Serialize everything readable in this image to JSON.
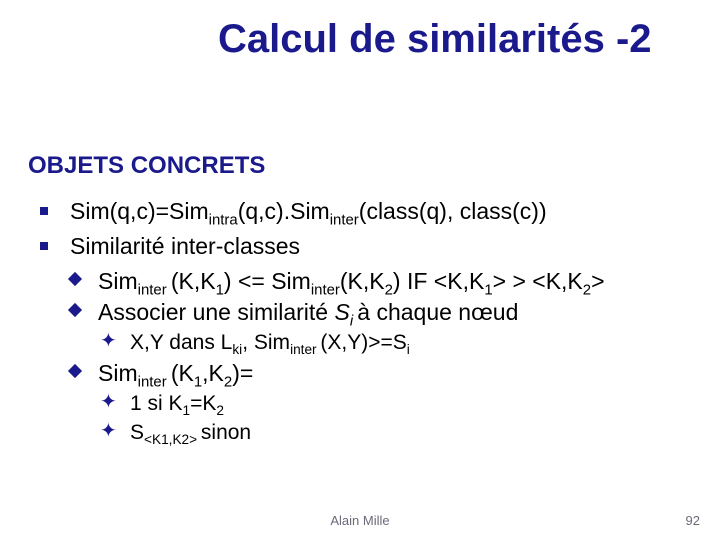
{
  "title": "Calcul de similarités -2",
  "section": "OBJETS CONCRETS",
  "b1": "Sim(q,c)=Sim",
  "b1a": "intra",
  "b1b": "(q,c).Sim",
  "b1c": "inter",
  "b1d": "(class(q), class(c))",
  "b2": "Similarité inter-classes",
  "c1a": "Sim",
  "c1b": "inter ",
  "c1c": "(K,K",
  "c1d": "1",
  "c1e": ") <= Sim",
  "c1f": "inter",
  "c1g": "(K,K",
  "c1h": "2",
  "c1i": ") IF <K,K",
  "c1j": "1",
  "c1k": "> > <K,K",
  "c1l": "2",
  "c1m": ">",
  "c2a": "Associer une similarité ",
  "c2b": "S",
  "c2c": "i ",
  "c2d": "à chaque nœud",
  "d1a": "X,Y dans L",
  "d1b": "ki",
  "d1c": ", Sim",
  "d1d": "inter ",
  "d1e": "(X,Y)>=S",
  "d1f": "i",
  "c3a": "Sim",
  "c3b": "inter ",
  "c3c": "(K",
  "c3d": "1",
  "c3e": ",K",
  "c3f": "2",
  "c3g": ")=",
  "e1a": "1 si K",
  "e1b": "1",
  "e1c": "=K",
  "e1d": "2",
  "e2a": "S",
  "e2b": "<K1,K2> ",
  "e2c": "sinon",
  "footer_center": "Alain Mille",
  "footer_right": "92"
}
